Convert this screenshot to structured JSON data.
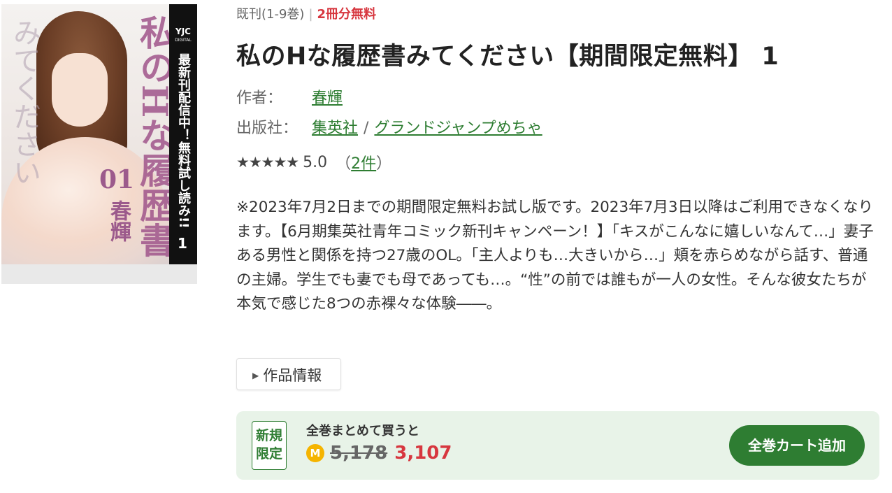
{
  "cover": {
    "band_brand": "YJC",
    "band_sub": "DIGITAL",
    "band_text": "最新刊配信中！無料試し読み!!",
    "band_volume": "1",
    "art_title": "私のHな履歴書",
    "art_title_small": "みてください",
    "art_volume": "01",
    "art_author": "春輝"
  },
  "availability": {
    "series": "既刊(1-9巻)",
    "free_notice": "2冊分無料"
  },
  "title": "私のHな履歴書みてください【期間限定無料】 1",
  "author": {
    "label": "作者：",
    "name": "春輝"
  },
  "publisher": {
    "label": "出版社：",
    "name": "集英社",
    "separator": "/",
    "label_name": "グランドジャンプめちゃ"
  },
  "rating": {
    "stars": 5,
    "score": "5.0",
    "open_paren": "（",
    "count": "2件",
    "close_paren": "）"
  },
  "description": "※2023年7月2日までの期間限定無料お試し版です。2023年7月3日以降はご利用できなくなります。【6月期集英社青年コミック新刊キャンペーン！】「キスがこんなに嬉しいなんて…」妻子ある男性と関係を持つ27歳のOL。「主人よりも…大きいから…」頬を赤らめながら話す、普通の主婦。学生でも妻でも母であっても…。“性”の前では誰もが一人の女性。そんな彼女たちが本気で感じた8つの赤裸々な体験――。",
  "info_button": "作品情報",
  "bundle": {
    "badge_line1": "新規",
    "badge_line2": "限定",
    "caption": "全巻まとめて買うと",
    "coin": "M",
    "old_price": "5,178",
    "new_price": "3,107",
    "cart_button": "全巻カート追加"
  },
  "colors": {
    "accent_green": "#2e7d32",
    "price_red": "#d7373f",
    "bundle_bg": "#e8f3e8",
    "coin_yellow": "#f5b400"
  }
}
